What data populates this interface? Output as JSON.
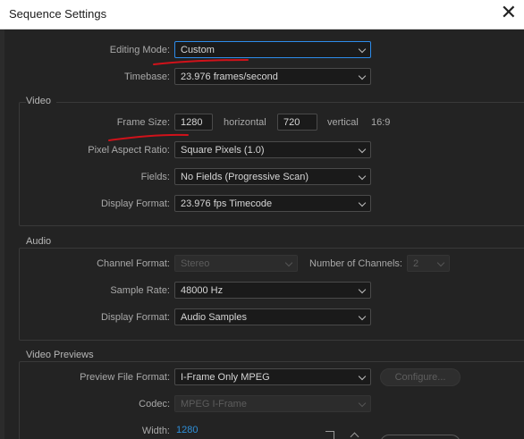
{
  "window": {
    "title": "Sequence Settings",
    "close_glyph": "✕"
  },
  "top": {
    "editing_mode_label": "Editing Mode:",
    "editing_mode_value": "Custom",
    "timebase_label": "Timebase:",
    "timebase_value": "23.976  frames/second"
  },
  "video": {
    "section_title": "Video",
    "frame_size_label": "Frame Size:",
    "frame_width": "1280",
    "horizontal_label": "horizontal",
    "frame_height": "720",
    "vertical_label": "vertical",
    "aspect_ratio": "16:9",
    "pixel_aspect_label": "Pixel Aspect Ratio:",
    "pixel_aspect_value": "Square Pixels (1.0)",
    "fields_label": "Fields:",
    "fields_value": "No Fields (Progressive Scan)",
    "display_format_label": "Display Format:",
    "display_format_value": "23.976 fps Timecode"
  },
  "audio": {
    "section_title": "Audio",
    "channel_format_label": "Channel Format:",
    "channel_format_value": "Stereo",
    "num_channels_label": "Number of Channels:",
    "num_channels_value": "2",
    "sample_rate_label": "Sample Rate:",
    "sample_rate_value": "48000 Hz",
    "display_format_label": "Display Format:",
    "display_format_value": "Audio Samples"
  },
  "previews": {
    "section_title": "Video Previews",
    "preview_format_label": "Preview File Format:",
    "preview_format_value": "I-Frame Only MPEG",
    "configure_label": "Configure...",
    "codec_label": "Codec:",
    "codec_value": "MPEG I-Frame",
    "width_label": "Width:",
    "width_value": "1280"
  },
  "colors": {
    "background": "#232323",
    "annotation_red": "#d0121a",
    "focus_blue": "#2d8ceb",
    "link_blue": "#2f8fd8"
  }
}
